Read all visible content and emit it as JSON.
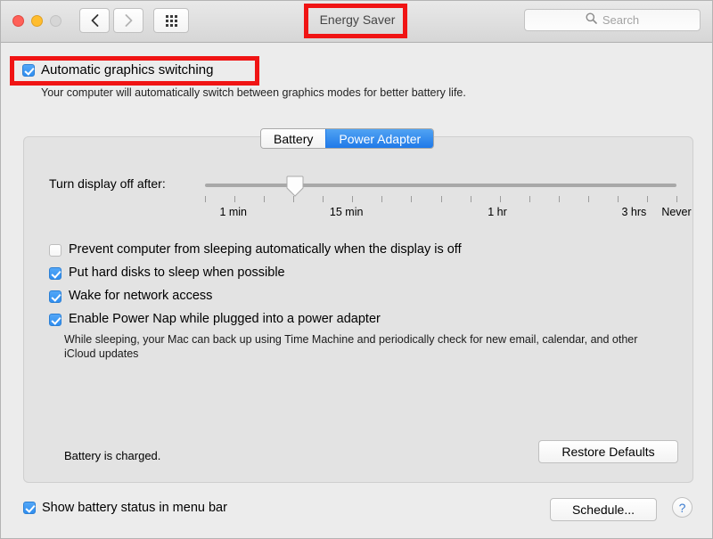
{
  "window": {
    "title": "Energy Saver",
    "traffic_lights": [
      "close",
      "minimize",
      "zoom"
    ],
    "nav": {
      "back": "back-chevron",
      "forward": "forward-chevron",
      "show_all": "grid-icon"
    }
  },
  "search": {
    "placeholder": "Search",
    "icon": "search-icon"
  },
  "auto_graphics": {
    "label": "Automatic graphics switching",
    "checked": true,
    "description": "Your computer will automatically switch between graphics modes for better battery life."
  },
  "tabs": [
    {
      "label": "Battery",
      "active": false
    },
    {
      "label": "Power Adapter",
      "active": true
    }
  ],
  "slider": {
    "label": "Turn display off after:",
    "tick_count": 17,
    "thumb_position_pct": 19,
    "tick_labels": [
      {
        "text": "1 min",
        "pos_pct": 6
      },
      {
        "text": "15 min",
        "pos_pct": 30
      },
      {
        "text": "1 hr",
        "pos_pct": 62
      },
      {
        "text": "3 hrs",
        "pos_pct": 91
      },
      {
        "text": "Never",
        "pos_pct": 100
      }
    ]
  },
  "options": [
    {
      "label": "Prevent computer from sleeping automatically when the display is off",
      "checked": false
    },
    {
      "label": "Put hard disks to sleep when possible",
      "checked": true
    },
    {
      "label": "Wake for network access",
      "checked": true
    },
    {
      "label": "Enable Power Nap while plugged into a power adapter",
      "checked": true
    }
  ],
  "power_nap_description": "While sleeping, your Mac can back up using Time Machine and periodically check for new email, calendar, and other iCloud updates",
  "battery_status": "Battery is charged.",
  "restore_defaults_label": "Restore Defaults",
  "show_battery_status": {
    "label": "Show battery status in menu bar",
    "checked": true
  },
  "schedule_label": "Schedule...",
  "help_label": "?",
  "colors": {
    "accent_blue": "#2f8ef0",
    "annotation_red": "#f01414",
    "window_bg": "#ececec",
    "panel_bg": "#e3e3e3"
  }
}
